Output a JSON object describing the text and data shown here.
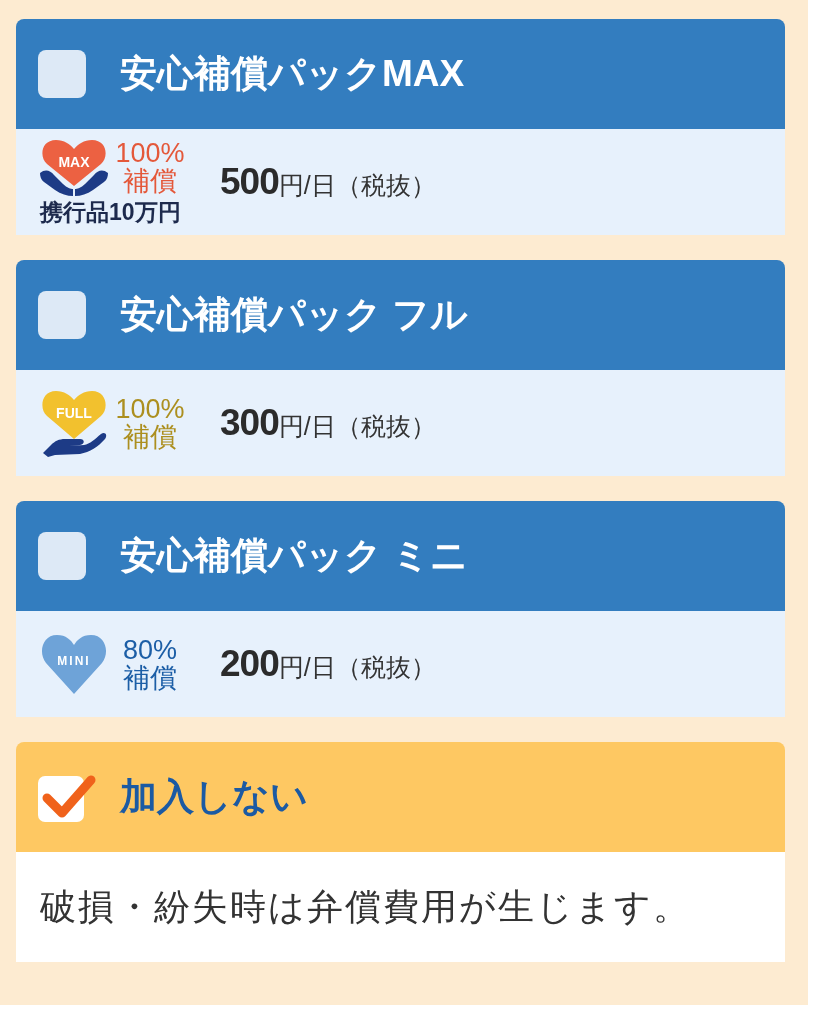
{
  "options": [
    {
      "kind": "plan",
      "title": "安心補償パックMAX",
      "checked": false,
      "badge": {
        "kind": "max",
        "label": "MAX",
        "color": "#ec6142"
      },
      "coverage": {
        "percent": "100%",
        "label": "補償",
        "color": "#e4583a",
        "note": "携行品10万円"
      },
      "price": {
        "amount": "500",
        "unit": "円/日（税抜）"
      }
    },
    {
      "kind": "plan",
      "title": "安心補償パック フル",
      "checked": false,
      "badge": {
        "kind": "full",
        "label": "FULL",
        "color": "#f2c12e"
      },
      "coverage": {
        "percent": "100%",
        "label": "補償",
        "color": "#ac8f1f"
      },
      "price": {
        "amount": "300",
        "unit": "円/日（税抜）"
      }
    },
    {
      "kind": "plan",
      "title": "安心補償パック ミニ",
      "checked": false,
      "badge": {
        "kind": "mini",
        "label": "MINI",
        "color": "#6ea3d8"
      },
      "coverage": {
        "percent": "80%",
        "label": "補償",
        "color": "#1c5ea6"
      },
      "price": {
        "amount": "200",
        "unit": "円/日（税抜）"
      }
    },
    {
      "kind": "decline",
      "title": "加入しない",
      "checked": true,
      "description": "破損・紛失時は弁償費用が生じます。"
    }
  ]
}
